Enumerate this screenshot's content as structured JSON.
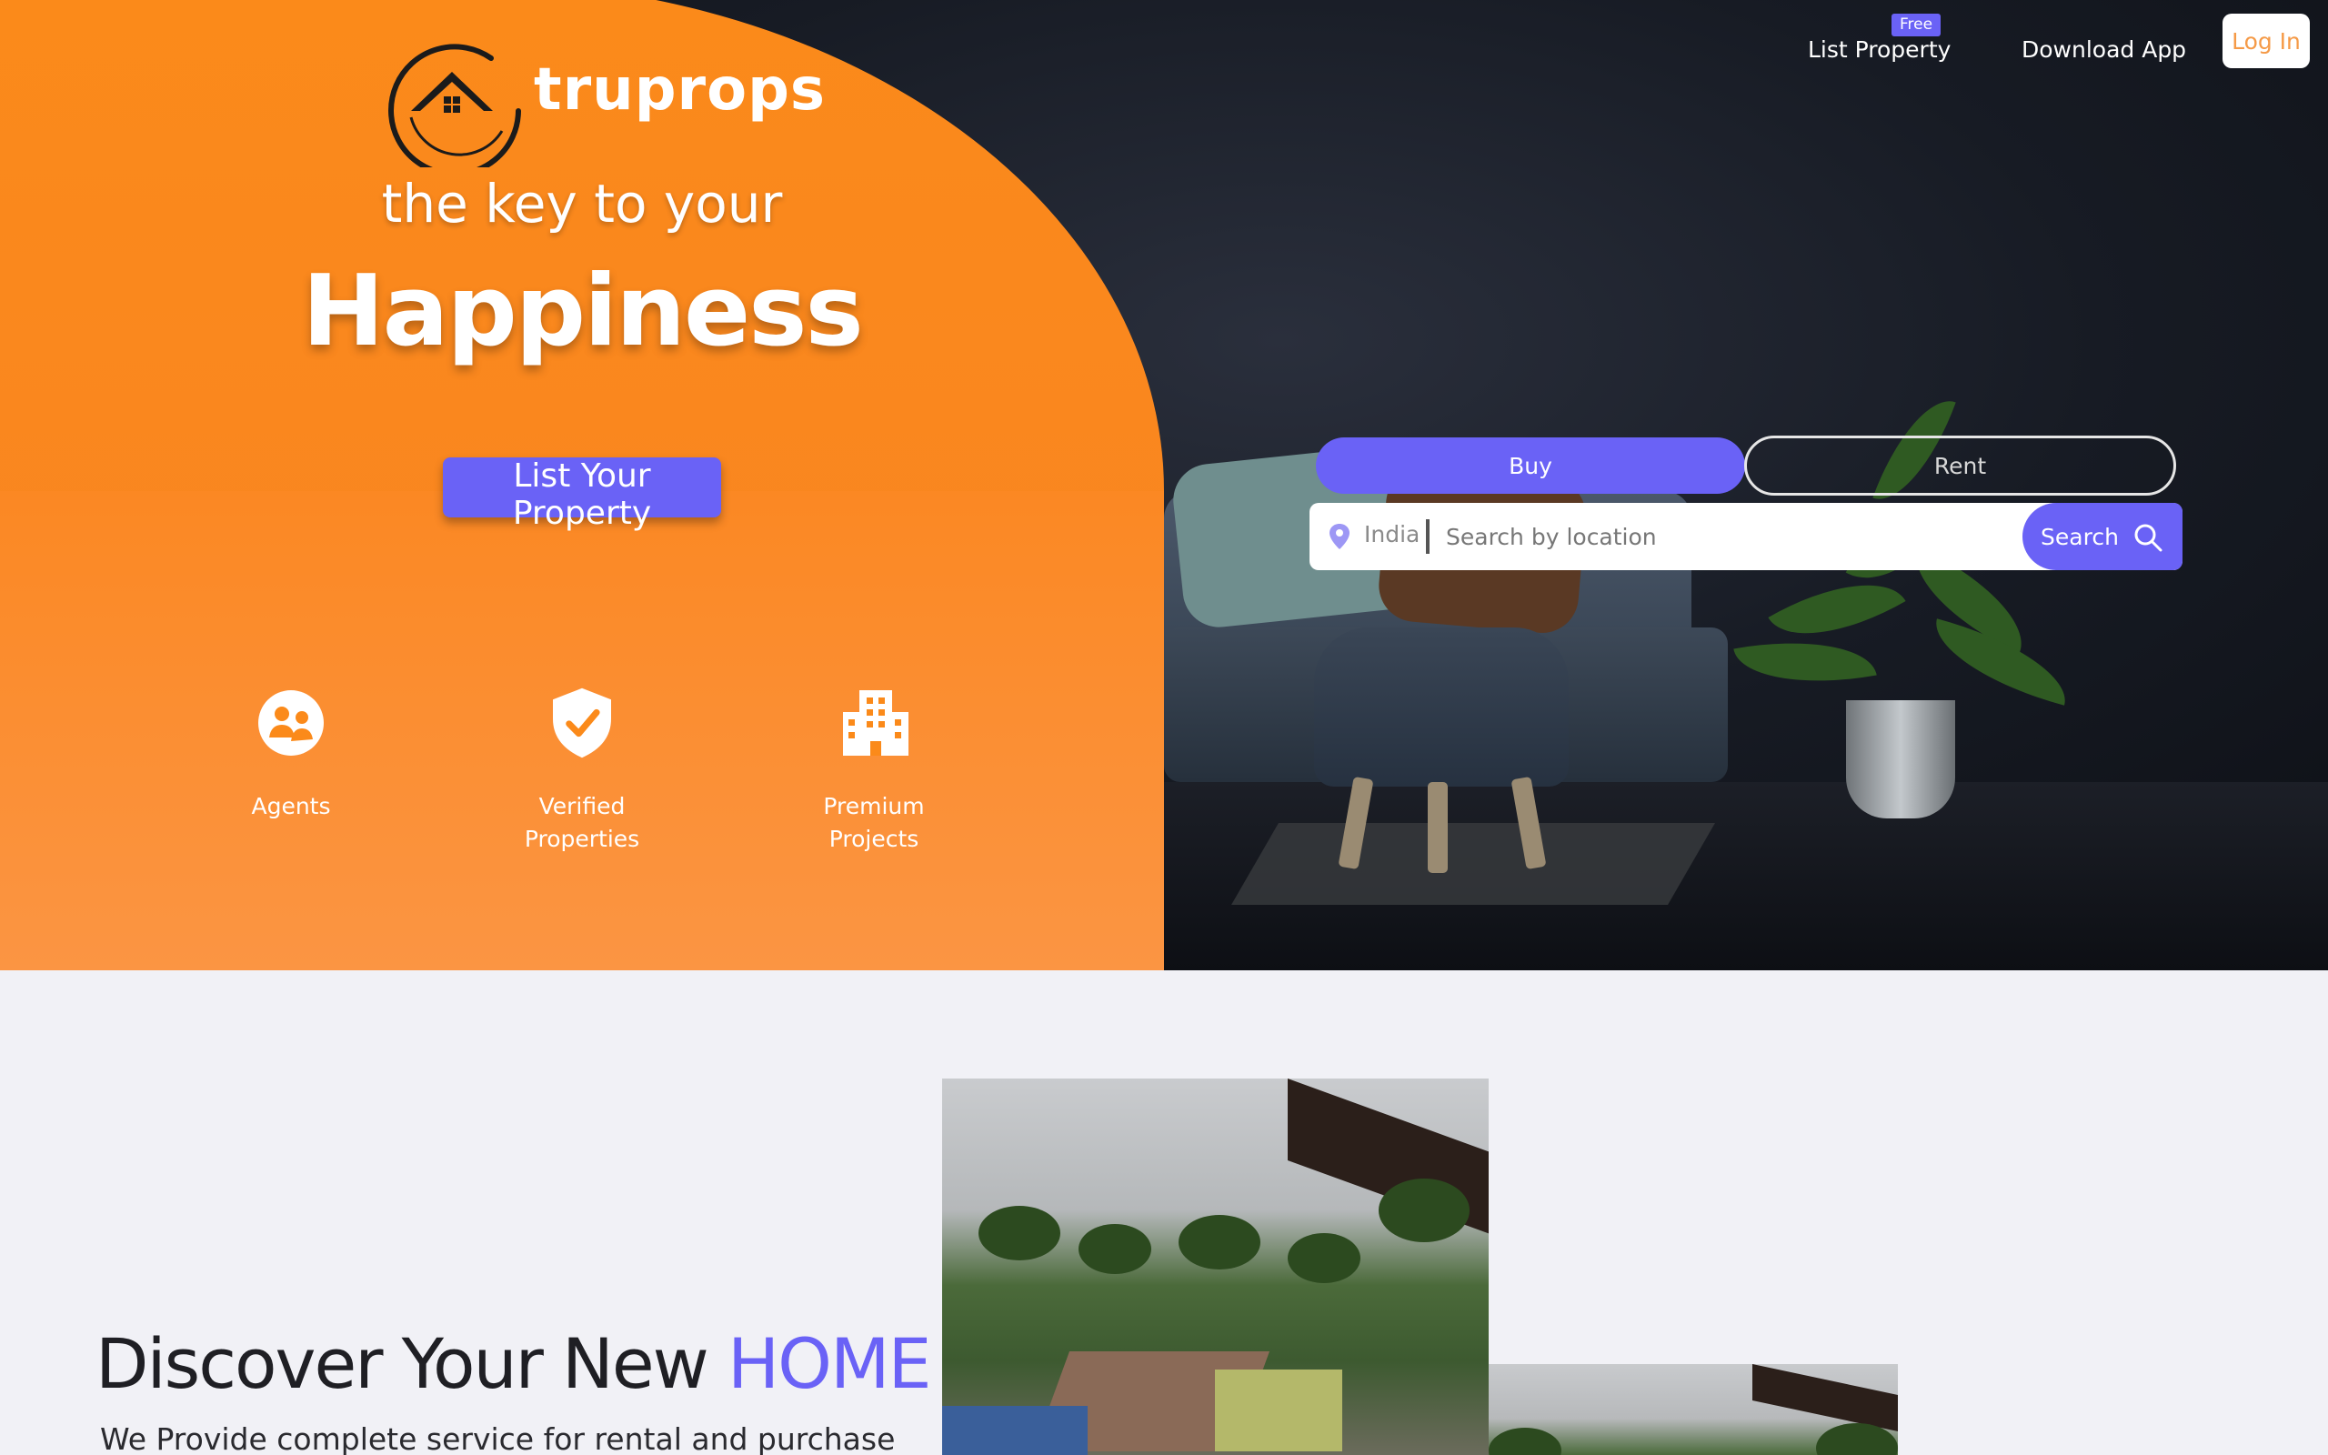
{
  "brand": {
    "name": "truprops"
  },
  "hero": {
    "tagline": "the key to your",
    "headline": "Happiness",
    "cta_label": "List Your Property"
  },
  "features": [
    {
      "label": "Agents",
      "icon": "agents-icon"
    },
    {
      "label": "Verified Properties",
      "icon": "verified-shield-icon"
    },
    {
      "label": "Premium Projects",
      "icon": "building-icon"
    }
  ],
  "nav": {
    "list_property_label": "List Property",
    "free_badge": "Free",
    "download_app_label": "Download App",
    "login_label": "Log In"
  },
  "search": {
    "tabs": [
      "Buy",
      "Rent"
    ],
    "active_tab": "Buy",
    "country": "India",
    "placeholder": "Search by location",
    "button_label": "Search"
  },
  "discover": {
    "title_main": "Discover Your New",
    "title_accent": "HOME",
    "subtitle": "We Provide complete service for rental and purchase"
  },
  "colors": {
    "brand_orange": "#fb8a1a",
    "accent_purple": "#6a62f6",
    "hero_dark": "#171b24",
    "section_bg": "#f1f1f6"
  }
}
